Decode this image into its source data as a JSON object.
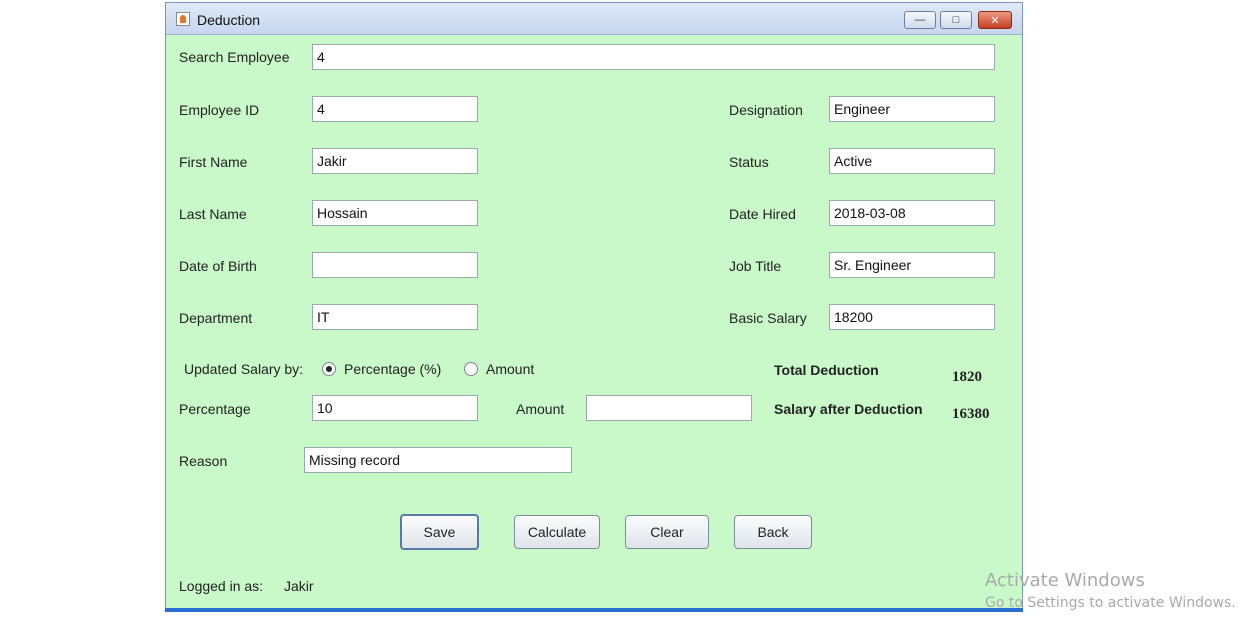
{
  "window": {
    "title": "Deduction"
  },
  "form": {
    "search_label": "Search Employee",
    "search_value": "4",
    "employee_id_label": "Employee ID",
    "employee_id_value": "4",
    "first_name_label": "First Name",
    "first_name_value": "Jakir",
    "last_name_label": "Last Name",
    "last_name_value": "Hossain",
    "dob_label": "Date of Birth",
    "dob_value": "",
    "department_label": "Department",
    "department_value": "IT",
    "designation_label": "Designation",
    "designation_value": "Engineer",
    "status_label": "Status",
    "status_value": "Active",
    "date_hired_label": "Date Hired",
    "date_hired_value": "2018-03-08",
    "job_title_label": "Job Title",
    "job_title_value": "Sr. Engineer",
    "basic_salary_label": "Basic Salary",
    "basic_salary_value": "18200",
    "updated_salary_label": "Updated Salary by:",
    "radio_percentage_label": "Percentage (%)",
    "radio_amount_label": "Amount",
    "radio_selected": "Percentage (%)",
    "percentage_label": "Percentage",
    "percentage_value": "10",
    "amount_label": "Amount",
    "amount_value": "",
    "reason_label": "Reason",
    "reason_value": "Missing record",
    "total_deduction_label": "Total Deduction",
    "total_deduction_value": "1820",
    "salary_after_label": "Salary after Deduction",
    "salary_after_value": "16380"
  },
  "buttons": {
    "save": "Save",
    "calculate": "Calculate",
    "clear": "Clear",
    "back": "Back"
  },
  "footer": {
    "logged_in_label": "Logged in as:",
    "logged_in_user": "Jakir"
  },
  "watermark": {
    "line1": "Activate Windows",
    "line2": "Go to Settings to activate Windows."
  },
  "colors": {
    "panel_background": "#c9f9c9",
    "titlebar": "#c6d6ee",
    "close_button": "#c63c1f"
  }
}
